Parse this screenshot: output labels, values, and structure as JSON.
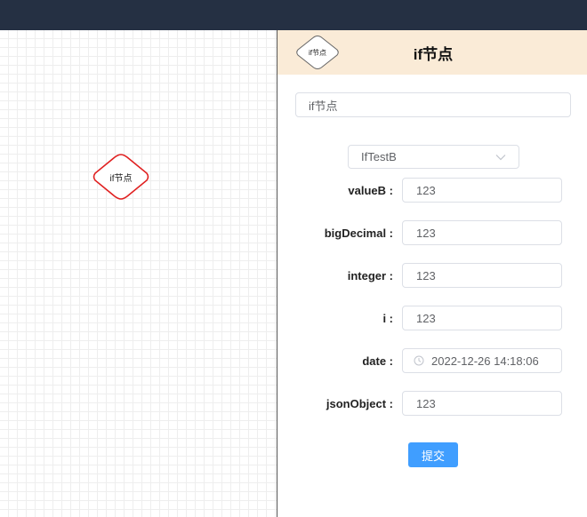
{
  "canvas": {
    "node": {
      "label": "if节点",
      "shape": "diamond-icon",
      "border_color": "#e02020"
    }
  },
  "panel": {
    "header": {
      "node_label": "if节点",
      "title": "if节点",
      "background": "#faebd7"
    },
    "name_input": {
      "value": "if节点"
    },
    "class_select": {
      "value": "IfTestB"
    },
    "fields": [
      {
        "label": "valueB :",
        "value": "123"
      },
      {
        "label": "bigDecimal :",
        "value": "123"
      },
      {
        "label": "integer :",
        "value": "123"
      },
      {
        "label": "i :",
        "value": "123"
      },
      {
        "label": "date :",
        "value": "2022-12-26 14:18:06",
        "icon": "clock-icon"
      },
      {
        "label": "jsonObject :",
        "value": "123"
      }
    ],
    "submit_label": "提交"
  },
  "colors": {
    "topbar": "#253043",
    "primary": "#409eff",
    "node_border": "#e02020"
  }
}
